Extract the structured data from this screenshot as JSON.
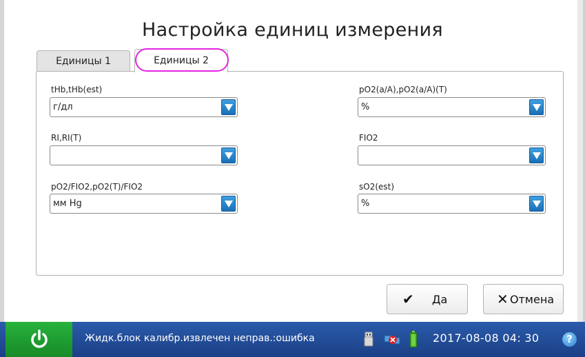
{
  "window": {
    "title": "Настройка единиц измерения"
  },
  "tabs": [
    {
      "label": "Единицы 1",
      "active": false
    },
    {
      "label": "Единицы 2",
      "active": true
    }
  ],
  "fields": {
    "left": [
      {
        "label": "tHb,tHb(est)",
        "value": "г/дл"
      },
      {
        "label": "RI,RI(T)",
        "value": ""
      },
      {
        "label": "pO2/FIO2,pO2(T)/FIO2",
        "value": "мм Hg"
      }
    ],
    "right": [
      {
        "label": "pO2(a/A),pO2(a/A)(T)",
        "value": "%"
      },
      {
        "label": "FIO2",
        "value": ""
      },
      {
        "label": "sO2(est)",
        "value": "%"
      }
    ]
  },
  "buttons": {
    "ok_label": "Да",
    "cancel_label": "Отмена",
    "ok_icon": "check-icon",
    "cancel_icon": "x-icon"
  },
  "statusbar": {
    "message": "Жидк.блок калибр.извлечен неправ.:ошибка",
    "datetime": "2017-08-08 04: 30",
    "help_label": "?",
    "icons": [
      "power-icon",
      "usb-icon",
      "network-error-icon",
      "battery-icon",
      "help-icon"
    ]
  },
  "colors": {
    "statusbar": "#2a5bab",
    "power": "#27b23c",
    "highlight": "#e224e0",
    "dropdown": "#2a86cc"
  }
}
